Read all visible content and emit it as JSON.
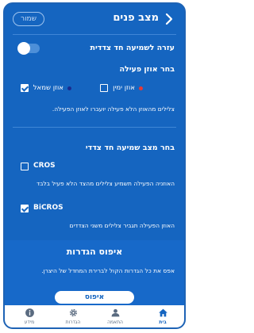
{
  "header": {
    "title": "מצב פנים",
    "save_label": "שמור"
  },
  "single_sided": {
    "label": "עזרה לשמיעה חד צדדית",
    "toggle_on": false
  },
  "active_ear": {
    "heading": "בחר אוזן פעילה",
    "right_label": "אוזן ימין",
    "left_label": "אוזן שמאל",
    "right_checked": false,
    "left_checked": true,
    "right_dot_color": "#e53935",
    "left_dot_color": "#1a2b8f",
    "description": "צלילים מהאוזן הלא פעילה יועברו לאוזן הפעילה."
  },
  "mode": {
    "heading": "בחר מצב שמיעה חד צדדי",
    "cros_label": "CROS",
    "cros_checked": false,
    "cros_description": "האוזניה הפעילה תשמיע צלילים מהצד הלא פעיל בלבד",
    "bicros_label": "BiCROS",
    "bicros_checked": true,
    "bicros_description": "האוזן הפעילה תגביר צלילים משני הצדדים"
  },
  "reset": {
    "title": "איפוס הגדרות",
    "description": "אפס את כל הגדרות הקול לברירת המחדל של היצרן.",
    "button_label": "איפוס"
  },
  "nav": {
    "items": [
      {
        "label": "בית",
        "icon": "home-icon",
        "active": true
      },
      {
        "label": "התאמה",
        "icon": "person-icon",
        "active": false
      },
      {
        "label": "הגדרות",
        "icon": "gear-icon",
        "active": false
      },
      {
        "label": "מידע",
        "icon": "info-icon",
        "active": false
      }
    ]
  },
  "colors": {
    "background": "#1565c0",
    "accent": "#ffffff",
    "nav_active": "#1565c0"
  }
}
